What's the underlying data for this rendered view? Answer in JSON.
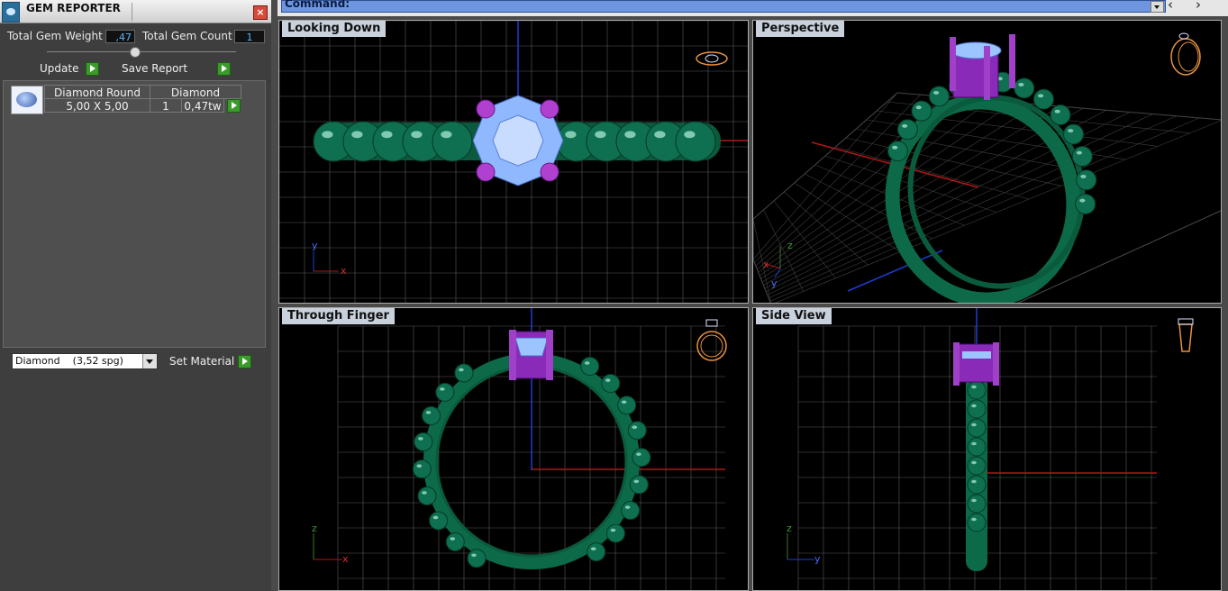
{
  "panel": {
    "title": "GEM REPORTER",
    "close_glyph": "×",
    "total_weight_label": "Total Gem Weight",
    "total_weight_value": ",47",
    "total_count_label": "Total Gem Count",
    "total_count_value": "1",
    "update_label": "Update",
    "save_report_label": "Save Report",
    "gem": {
      "name": "Diamond Round",
      "size": "5,00 X 5,00",
      "material": "Diamond",
      "count": "1",
      "weight": "0,47tw"
    },
    "material_select": "Diamond    (3,52 spg)",
    "set_material_label": "Set Material"
  },
  "command": {
    "label": "Command:",
    "nav_back": "‹",
    "nav_forward": "›"
  },
  "viewports": {
    "top_left": {
      "label": "Looking Down",
      "axis_a": "y",
      "axis_b": "x"
    },
    "top_right": {
      "label": "Perspective",
      "axis_a": "z",
      "axis_b": "x",
      "axis_c": "y"
    },
    "bottom_left": {
      "label": "Through Finger",
      "axis_a": "z",
      "axis_b": "x"
    },
    "bottom_right": {
      "label": "Side View",
      "axis_a": "z",
      "axis_b": "y"
    }
  },
  "colors": {
    "band": "#0e6a4a",
    "prong": "#8a2ab8",
    "stone": "#9cc4ff",
    "axis_x": "#b01818",
    "axis_y": "#1a3fd0",
    "grid": "#5a5a5a"
  },
  "icons": [
    "app-icon",
    "close-icon",
    "play-icon",
    "dropdown-icon",
    "gem-thumbnail",
    "ring-view-icon"
  ]
}
